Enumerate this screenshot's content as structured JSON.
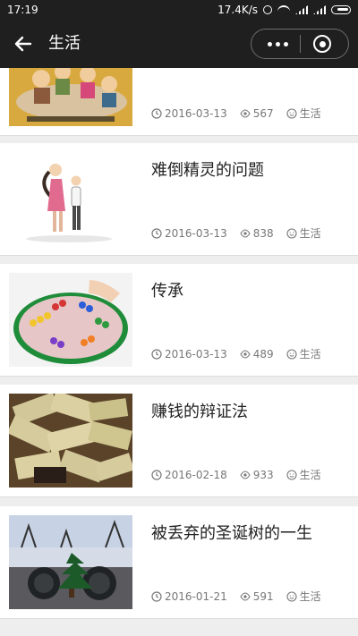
{
  "status_bar": {
    "time": "17:19",
    "speed": "17.4K/s"
  },
  "header": {
    "title": "生活",
    "back_icon": "back-arrow-icon",
    "more_icon": "more-dots-icon",
    "close_icon": "target-close-icon"
  },
  "articles": [
    {
      "title": "",
      "date": "2016-03-13",
      "views": "567",
      "category": "生活",
      "thumbnail": "family-dinner-illustration"
    },
    {
      "title": "难倒精灵的问题",
      "date": "2016-03-13",
      "views": "838",
      "category": "生活",
      "thumbnail": "couple-illustration"
    },
    {
      "title": "传承",
      "date": "2016-03-13",
      "views": "489",
      "category": "生活",
      "thumbnail": "chinese-checkers-photo"
    },
    {
      "title": "赚钱的辩证法",
      "date": "2016-02-18",
      "views": "933",
      "category": "生活",
      "thumbnail": "money-pile-photo"
    },
    {
      "title": "被丢弃的圣诞树的一生",
      "date": "2016-01-21",
      "views": "591",
      "category": "生活",
      "thumbnail": "discarded-christmas-tree-photo"
    }
  ]
}
